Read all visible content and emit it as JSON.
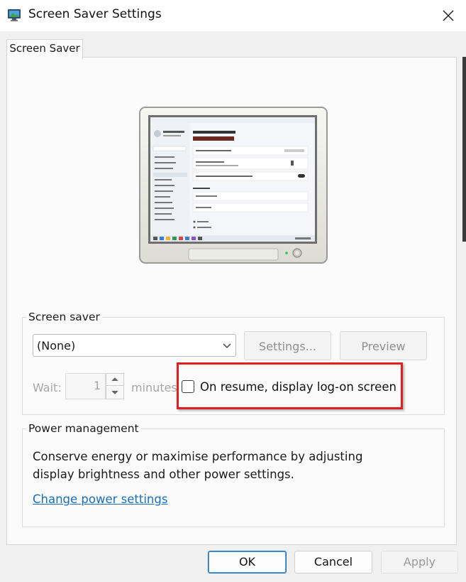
{
  "window": {
    "title": "Screen Saver Settings",
    "icon": "screen-saver-app-icon",
    "close_icon": "close-icon"
  },
  "tabs": [
    {
      "label": "Screen Saver",
      "selected": true
    }
  ],
  "preview": {
    "description": "monitor-preview-icon"
  },
  "screen_saver": {
    "group_label": "Screen saver",
    "selected": "(None)",
    "settings_label": "Settings...",
    "preview_label": "Preview",
    "wait_label": "Wait:",
    "wait_value": "1",
    "minutes_label": "minutes",
    "resume_checkbox_label": "On resume, display log-on screen",
    "resume_checked": false
  },
  "power": {
    "group_label": "Power management",
    "text_line1": "Conserve energy or maximise performance by adjusting",
    "text_line2": "display brightness and other power settings.",
    "link_label": "Change power settings"
  },
  "footer": {
    "ok_label": "OK",
    "cancel_label": "Cancel",
    "apply_label": "Apply"
  },
  "colors": {
    "accent": "#1a6fb8",
    "highlight_box": "#e02020",
    "panel_bg": "#fbfbfb",
    "window_bg": "#f0f0f0"
  }
}
